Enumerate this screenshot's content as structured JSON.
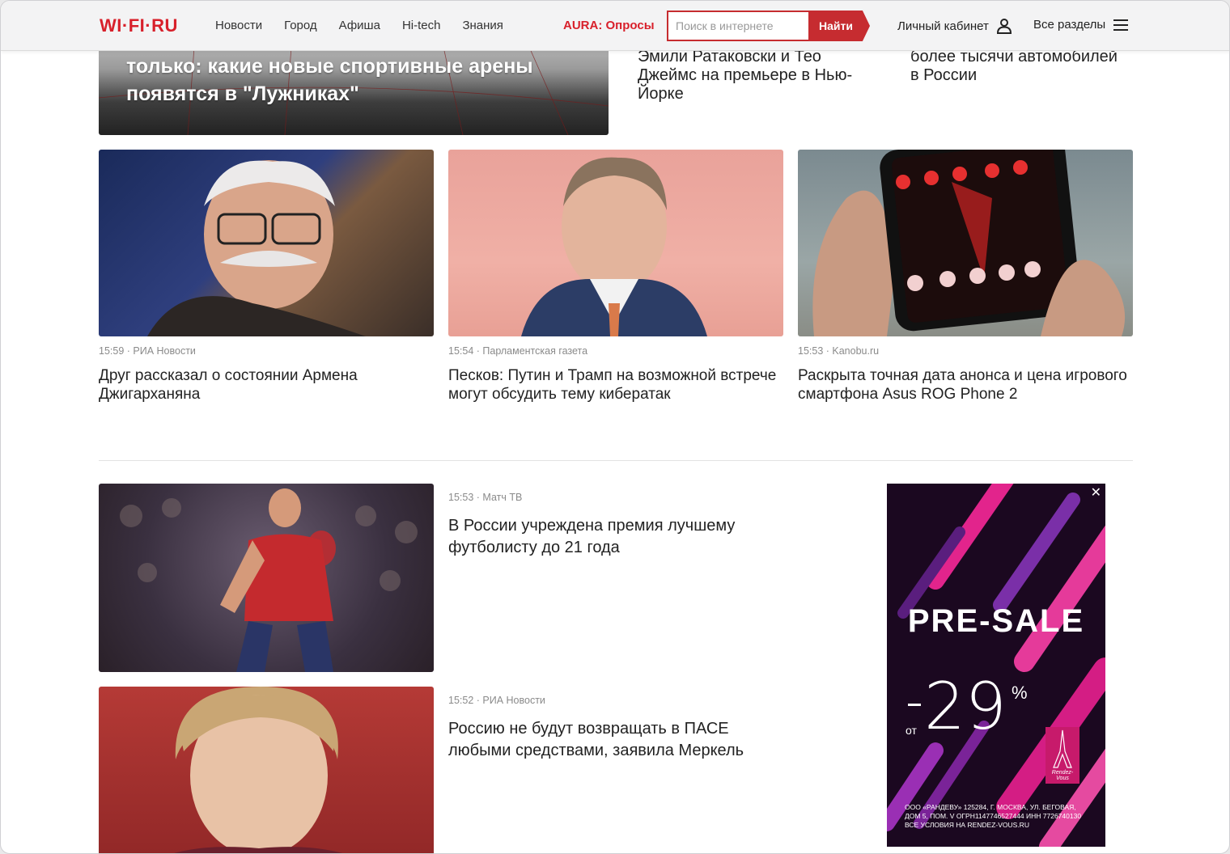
{
  "header": {
    "logo": "WI·FI·RU",
    "nav": [
      "Новости",
      "Город",
      "Афиша",
      "Hi-tech",
      "Знания"
    ],
    "aura_link": "AURA: Опросы",
    "search_placeholder": "Поиск в интернете",
    "search_button": "Найти",
    "cabinet": "Личный кабинет",
    "all_sections": "Все разделы"
  },
  "feature": {
    "title": "только: какие новые спортивные арены появятся в \"Лужниках\""
  },
  "top_items": [
    {
      "title": "Эмили Ратаковски и Тео Джеймс на премьере в Нью-Йорке"
    },
    {
      "title": "более тысячи автомобилей в России"
    }
  ],
  "cards": [
    {
      "time": "15:59",
      "source": "РИА Новости",
      "title": "Друг рассказал о состоянии Армена Джигарханяна"
    },
    {
      "time": "15:54",
      "source": "Парламентская газета",
      "title": "Песков: Путин и Трамп на возможной встрече могут обсудить тему кибератак"
    },
    {
      "time": "15:53",
      "source": "Kanobu.ru",
      "title": "Раскрыта точная дата анонса и цена игрового смартфона Asus ROG Phone 2"
    }
  ],
  "list": [
    {
      "time": "15:53",
      "source": "Матч ТВ",
      "title": "В России учреждена премия лучшему футболисту до 21 года"
    },
    {
      "time": "15:52",
      "source": "РИА Новости",
      "title": "Россию не будут возвращать в ПАСЕ любыми средствами, заявила Меркель"
    }
  ],
  "ad": {
    "close": "✕",
    "headline": "PRE-SALE",
    "discount": "29",
    "percent": "%",
    "prefix": "от",
    "brand": "Rendez-Vous",
    "legal": "ООО «РАНДЕВУ» 125284, Г. МОСКВА, УЛ. БЕГОВАЯ, ДОМ 5, ПОМ. V ОГРН1147746527444 ИНН 7726740130 ВСЕ УСЛОВИЯ НА RENDEZ-VOUS.RU"
  }
}
